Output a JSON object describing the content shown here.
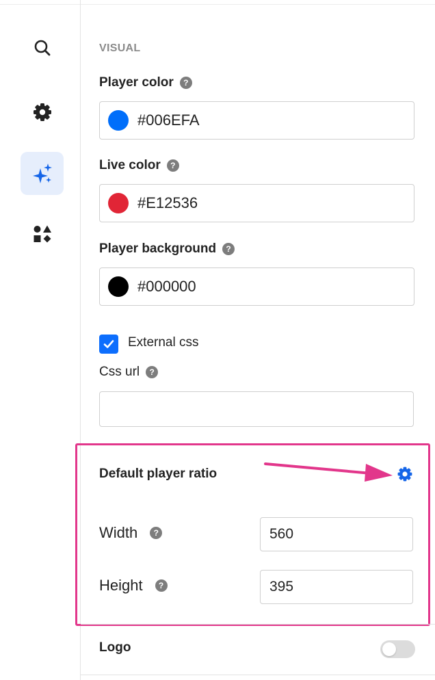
{
  "section": {
    "title": "VISUAL"
  },
  "player_color": {
    "label": "Player color",
    "help": "?",
    "value": "#006EFA",
    "swatch": "#006EFA"
  },
  "live_color": {
    "label": "Live color",
    "help": "?",
    "value": "#E12536",
    "swatch": "#E12536"
  },
  "player_background": {
    "label": "Player background",
    "help": "?",
    "value": "#000000",
    "swatch": "#000000"
  },
  "external_css": {
    "label": "External css",
    "checked": true
  },
  "css_url": {
    "label": "Css url",
    "help": "?",
    "value": ""
  },
  "player_ratio": {
    "title": "Default player ratio",
    "width_label": "Width",
    "width_help": "?",
    "width_value": "560",
    "height_label": "Height",
    "height_help": "?",
    "height_value": "395"
  },
  "logo": {
    "label": "Logo",
    "enabled": false
  },
  "sidebar": {
    "items": [
      {
        "name": "search",
        "icon": "search-icon"
      },
      {
        "name": "settings",
        "icon": "gear-icon"
      },
      {
        "name": "visual",
        "icon": "sparkles-icon",
        "active": true
      },
      {
        "name": "widgets",
        "icon": "shapes-icon"
      }
    ]
  },
  "colors": {
    "accent": "#0D6EFD",
    "highlight": "#E2368B",
    "active_bg": "#E6EEFC"
  }
}
